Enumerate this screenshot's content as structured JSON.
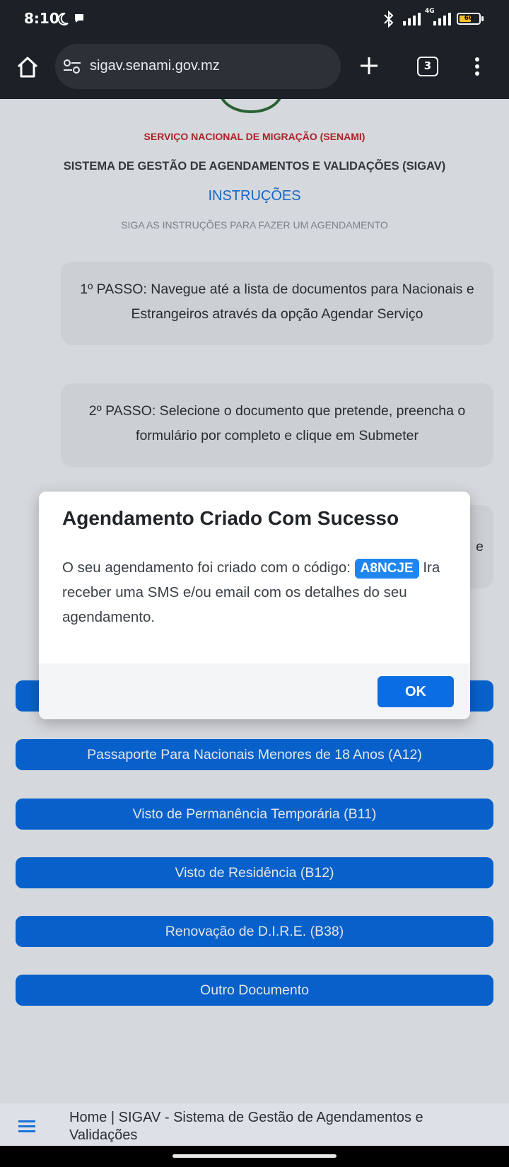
{
  "status_bar": {
    "time": "8:10",
    "network": "4G",
    "battery": "60"
  },
  "browser": {
    "url": "sigav.senami.gov.mz",
    "tab_count": "3"
  },
  "page": {
    "org_name": "SERVIÇO NACIONAL DE MIGRAÇÃO (SENAMI)",
    "system_name": "SISTEMA DE GESTÃO DE AGENDAMENTOS E VALIDAÇÕES (SIGAV)",
    "instructions_title": "INSTRUÇÕES",
    "instructions_subtitle": "SIGA AS INSTRUÇÕES PARA FAZER UM AGENDAMENTO",
    "steps": [
      "1º PASSO: Navegue até a lista de documentos para Nacionais e Estrangeiros através da opção Agendar Serviço",
      "2º PASSO: Selecione o documento que pretende, preencha o formulário por completo e clique em Submeter",
      "e"
    ],
    "services": [
      "",
      "Passaporte Para Nacionais Menores de 18 Anos (A12)",
      "Visto de Permanência Temporária (B11)",
      "Visto de Residência (B12)",
      "Renovação de D.I.R.E. (B38)",
      "Outro Documento"
    ]
  },
  "modal": {
    "title": "Agendamento Criado Com Sucesso",
    "message_prefix": "O seu agendamento foi criado com o código:",
    "code": "A8NCJE",
    "message_suffix": "Ira receber uma SMS e/ou email com os detalhes do seu agendamento.",
    "ok_label": "OK"
  },
  "bottom_bar": {
    "title": "Home | SIGAV - Sistema de Gestão de Agendamentos e Validações"
  },
  "colors": {
    "primary": "#0a6de3",
    "accent_red": "#c0272d",
    "link_blue": "#1a73d9"
  }
}
